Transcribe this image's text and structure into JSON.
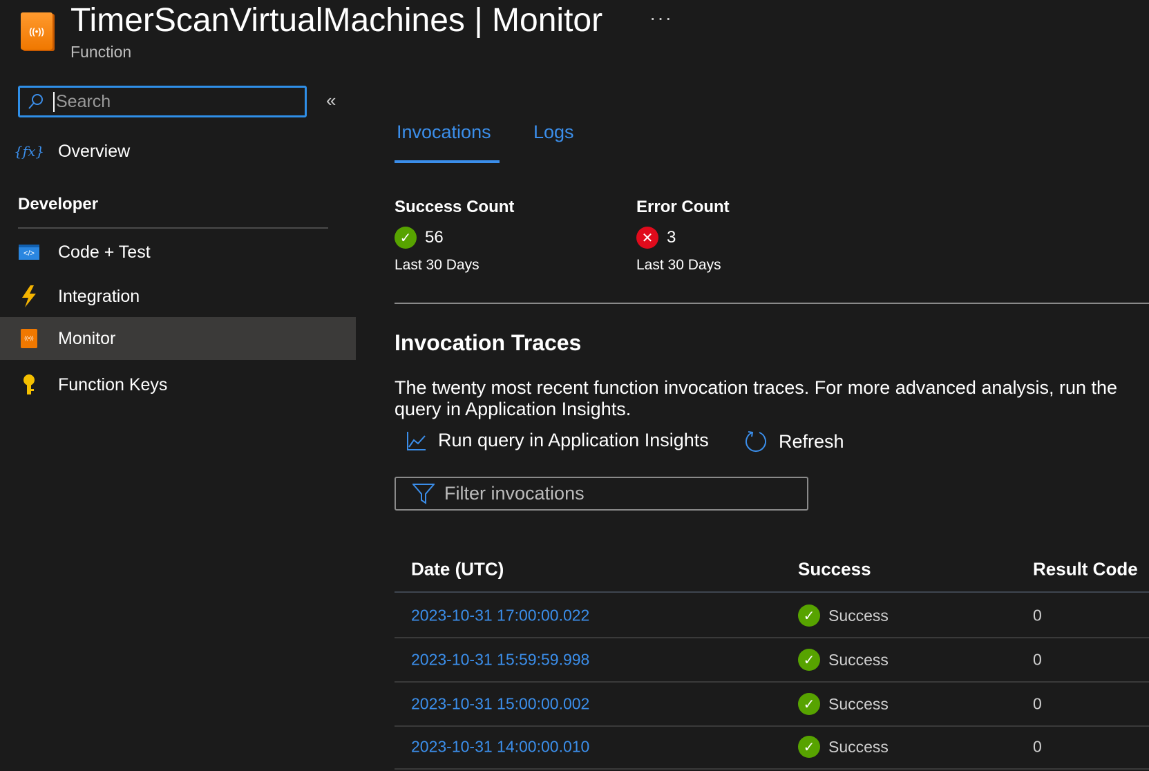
{
  "header": {
    "title": "TimerScanVirtualMachines | Monitor",
    "subtitle": "Function",
    "more": "···",
    "logo_text": "((•))"
  },
  "sidebar": {
    "search_placeholder": "Search",
    "collapse": "«",
    "overview": "Overview",
    "section": "Developer",
    "items": [
      {
        "label": "Code + Test"
      },
      {
        "label": "Integration"
      },
      {
        "label": "Monitor"
      },
      {
        "label": "Function Keys"
      }
    ]
  },
  "tabs": [
    {
      "label": "Invocations"
    },
    {
      "label": "Logs"
    }
  ],
  "stats": {
    "success": {
      "title": "Success Count",
      "value": "56",
      "period": "Last 30 Days"
    },
    "error": {
      "title": "Error Count",
      "value": "3",
      "period": "Last 30 Days"
    }
  },
  "traces": {
    "title": "Invocation Traces",
    "description": "The twenty most recent function invocation traces. For more advanced analysis, run the query in Application Insights.",
    "run_query": "Run query in Application Insights",
    "refresh": "Refresh",
    "filter_placeholder": "Filter invocations",
    "columns": [
      "Date (UTC)",
      "Success",
      "Result Code"
    ],
    "rows": [
      {
        "date": "2023-10-31 17:00:00.022",
        "success": "Success",
        "code": "0"
      },
      {
        "date": "2023-10-31 15:59:59.998",
        "success": "Success",
        "code": "0"
      },
      {
        "date": "2023-10-31 15:00:00.002",
        "success": "Success",
        "code": "0"
      },
      {
        "date": "2023-10-31 14:00:00.010",
        "success": "Success",
        "code": "0"
      }
    ]
  },
  "colors": {
    "accent": "#3b8eea",
    "success": "#57a300",
    "error": "#e00b1c"
  }
}
